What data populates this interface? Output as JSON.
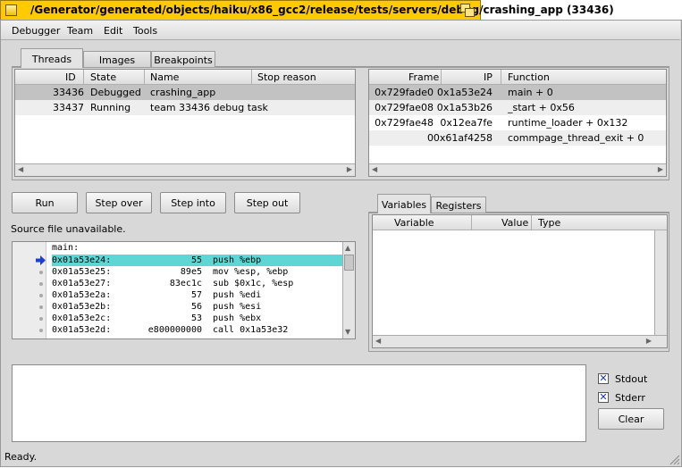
{
  "window": {
    "title": "/Generator/generated/objects/haiku/x86_gcc2/release/tests/servers/debug/crashing_app (33436)"
  },
  "menubar": {
    "items": [
      "Debugger",
      "Team",
      "Edit",
      "Tools"
    ]
  },
  "threads_tabs": [
    "Threads",
    "Images",
    "Breakpoints"
  ],
  "threads_table": {
    "columns": [
      "ID",
      "State",
      "Name",
      "Stop reason"
    ],
    "rows": [
      {
        "id": "33436",
        "state": "Debugged",
        "name": "crashing_app",
        "stop_reason": ""
      },
      {
        "id": "33437",
        "state": "Running",
        "name": "team 33436 debug task",
        "stop_reason": ""
      }
    ]
  },
  "stack_table": {
    "columns": [
      "Frame",
      "IP",
      "Function"
    ],
    "rows": [
      {
        "frame": "0x729fade0",
        "ip": "0x1a53e24",
        "function": "main + 0"
      },
      {
        "frame": "0x729fae08",
        "ip": "0x1a53b26",
        "function": "_start + 0x56"
      },
      {
        "frame": "0x729fae48",
        "ip": "0x12ea7fe",
        "function": "runtime_loader + 0x132"
      },
      {
        "frame": "0",
        "ip": "0x61af4258",
        "function": "commpage_thread_exit + 0"
      }
    ]
  },
  "controls": {
    "run": "Run",
    "step_over": "Step over",
    "step_into": "Step into",
    "step_out": "Step out"
  },
  "source": {
    "status": "Source file unavailable.",
    "label": "main:",
    "lines": [
      {
        "addr": "0x01a53e24:",
        "bytes": "55",
        "instr": "push %ebp"
      },
      {
        "addr": "0x01a53e25:",
        "bytes": "89e5",
        "instr": "mov %esp, %ebp"
      },
      {
        "addr": "0x01a53e27:",
        "bytes": "83ec1c",
        "instr": "sub $0x1c, %esp"
      },
      {
        "addr": "0x01a53e2a:",
        "bytes": "57",
        "instr": "push %edi"
      },
      {
        "addr": "0x01a53e2b:",
        "bytes": "56",
        "instr": "push %esi"
      },
      {
        "addr": "0x01a53e2c:",
        "bytes": "53",
        "instr": "push %ebx"
      },
      {
        "addr": "0x01a53e2d:",
        "bytes": "e800000000",
        "instr": "call 0x1a53e32"
      }
    ]
  },
  "vars_tabs": [
    "Variables",
    "Registers"
  ],
  "variables_table": {
    "columns": [
      "Variable",
      "Value",
      "Type"
    ]
  },
  "console": {
    "stdout_label": "Stdout",
    "stderr_label": "Stderr",
    "stdout_checked": true,
    "stderr_checked": true,
    "clear": "Clear"
  },
  "status": {
    "text": "Ready."
  },
  "colors": {
    "title_bar": "#ffcb00",
    "current_line": "#5ed6d4",
    "pc_arrow": "#1a3fd1"
  }
}
